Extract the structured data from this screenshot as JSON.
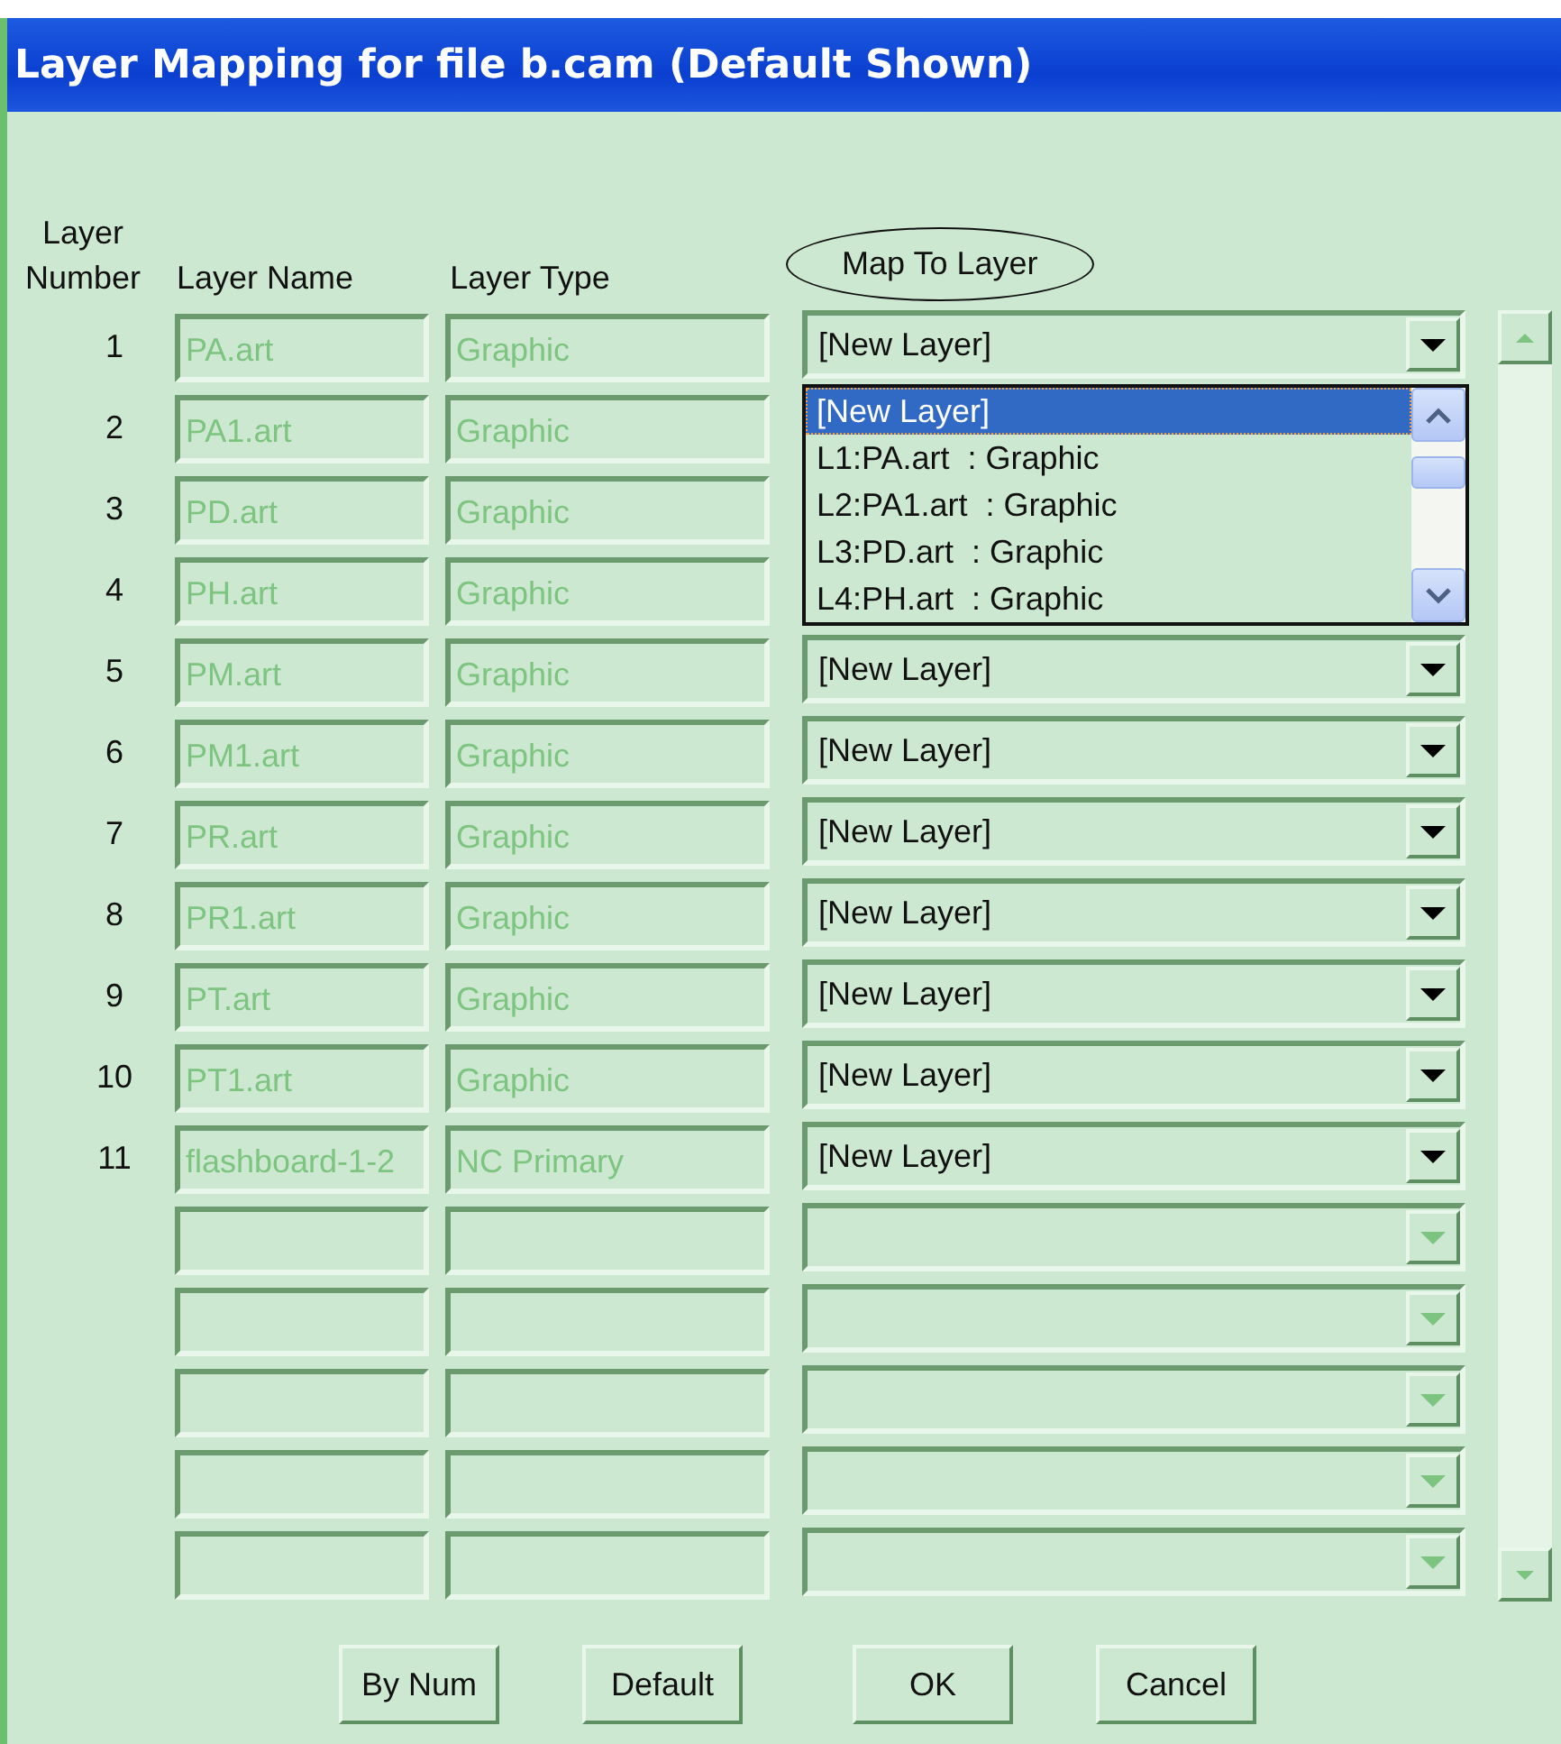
{
  "window": {
    "title": "Layer Mapping for file b.cam (Default Shown)"
  },
  "headers": {
    "number": "Layer Number",
    "name": "Layer Name",
    "type": "Layer Type",
    "map_to": "Map To Layer"
  },
  "rows": [
    {
      "number": "1",
      "name": "PA.art",
      "type": "Graphic",
      "map_to": "[New Layer]",
      "enabled": true
    },
    {
      "number": "2",
      "name": "PA1.art",
      "type": "Graphic"
    },
    {
      "number": "3",
      "name": "PD.art",
      "type": "Graphic"
    },
    {
      "number": "4",
      "name": "PH.art",
      "type": "Graphic"
    },
    {
      "number": "5",
      "name": "PM.art",
      "type": "Graphic",
      "map_to": "[New Layer]",
      "enabled": true
    },
    {
      "number": "6",
      "name": "PM1.art",
      "type": "Graphic",
      "map_to": "[New Layer]",
      "enabled": true
    },
    {
      "number": "7",
      "name": "PR.art",
      "type": "Graphic",
      "map_to": "[New Layer]",
      "enabled": true
    },
    {
      "number": "8",
      "name": "PR1.art",
      "type": "Graphic",
      "map_to": "[New Layer]",
      "enabled": true
    },
    {
      "number": "9",
      "name": "PT.art",
      "type": "Graphic",
      "map_to": "[New Layer]",
      "enabled": true
    },
    {
      "number": "10",
      "name": "PT1.art",
      "type": "Graphic",
      "map_to": "[New Layer]",
      "enabled": true
    },
    {
      "number": "11",
      "name": "flashboard-1-2",
      "type": "NC Primary",
      "map_to": "[New Layer]",
      "enabled": true
    },
    {
      "enabled": false
    },
    {
      "enabled": false
    },
    {
      "enabled": false
    },
    {
      "enabled": false
    },
    {
      "enabled": false
    }
  ],
  "dropdown_list": [
    {
      "label": "[New Layer]",
      "selected": true
    },
    {
      "label": "L1:PA.art  : Graphic",
      "selected": false
    },
    {
      "label": "L2:PA1.art  : Graphic",
      "selected": false
    },
    {
      "label": "L3:PD.art  : Graphic",
      "selected": false
    },
    {
      "label": "L4:PH.art  : Graphic",
      "selected": false
    }
  ],
  "buttons": [
    "By Num",
    "Default",
    "OK",
    "Cancel"
  ]
}
